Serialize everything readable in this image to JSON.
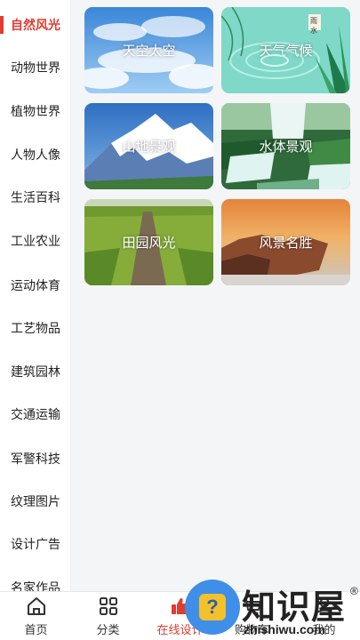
{
  "sidebar": {
    "active_color": "#e23b2f",
    "items": [
      {
        "label": "自然风光",
        "active": true
      },
      {
        "label": "动物世界"
      },
      {
        "label": "植物世界"
      },
      {
        "label": "人物人像"
      },
      {
        "label": "生活百科"
      },
      {
        "label": "工业农业"
      },
      {
        "label": "运动体育"
      },
      {
        "label": "工艺物品"
      },
      {
        "label": "建筑园林"
      },
      {
        "label": "交通运输"
      },
      {
        "label": "军警科技"
      },
      {
        "label": "纹理图片"
      },
      {
        "label": "设计广告"
      },
      {
        "label": "名家作品"
      }
    ]
  },
  "categories": [
    {
      "label": "天空太空",
      "image": "blue-sky-clouds"
    },
    {
      "label": "天气气候",
      "image": "water-ripple-leaves"
    },
    {
      "label": "山地景观",
      "image": "snow-mountain"
    },
    {
      "label": "水体景观",
      "image": "waterfall"
    },
    {
      "label": "田园风光",
      "image": "countryside-boardwalk"
    },
    {
      "label": "风景名胜",
      "image": "sunset-rocks"
    }
  ],
  "weather_card_stamp": "雨水",
  "tabbar": {
    "items": [
      {
        "label": "首页",
        "icon": "home-icon"
      },
      {
        "label": "分类",
        "icon": "grid-icon"
      },
      {
        "label": "在线设计",
        "icon": "thumbs-up-icon",
        "active": true
      },
      {
        "label": "购物车",
        "icon": "cart-icon"
      },
      {
        "label": "我的",
        "icon": "user-icon"
      }
    ]
  },
  "watermark": {
    "badge": "?",
    "title": "知识屋",
    "registered": "®",
    "url": "zhishiwu.com"
  }
}
